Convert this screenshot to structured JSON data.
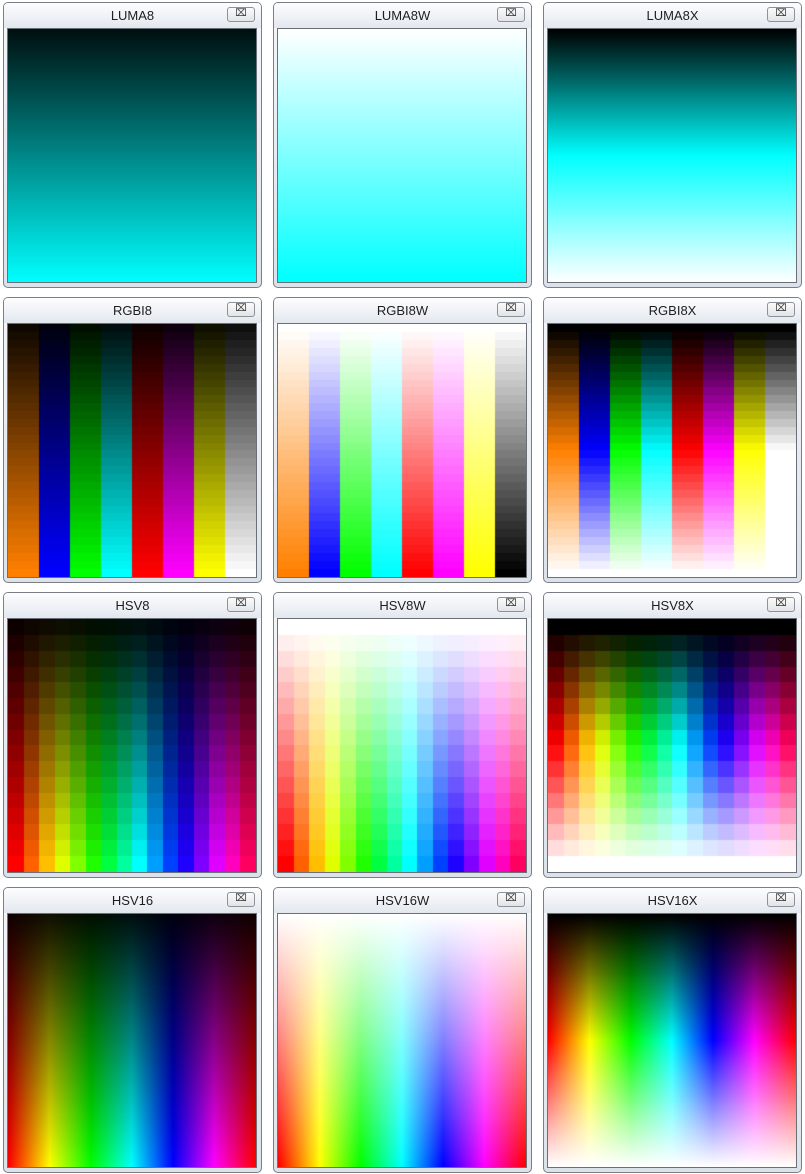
{
  "windows": [
    {
      "title": "LUMA8",
      "scheme": "luma",
      "mode": "dark",
      "steps": 0
    },
    {
      "title": "LUMA8W",
      "scheme": "luma",
      "mode": "white",
      "steps": 0
    },
    {
      "title": "LUMA8X",
      "scheme": "luma",
      "mode": "both",
      "steps": 0
    },
    {
      "title": "RGBI8",
      "scheme": "rgbi",
      "mode": "dark",
      "steps": 32
    },
    {
      "title": "RGBI8W",
      "scheme": "rgbi",
      "mode": "white",
      "steps": 32
    },
    {
      "title": "RGBI8X",
      "scheme": "rgbi",
      "mode": "both",
      "steps": 32
    },
    {
      "title": "HSV8",
      "scheme": "hsv",
      "mode": "dark",
      "steps": 16
    },
    {
      "title": "HSV8W",
      "scheme": "hsv",
      "mode": "white",
      "steps": 16
    },
    {
      "title": "HSV8X",
      "scheme": "hsv",
      "mode": "both",
      "steps": 16
    },
    {
      "title": "HSV16",
      "scheme": "hsv",
      "mode": "dark",
      "steps": 0
    },
    {
      "title": "HSV16W",
      "scheme": "hsv",
      "mode": "white",
      "steps": 0
    },
    {
      "title": "HSV16X",
      "scheme": "hsv",
      "mode": "both",
      "steps": 0
    }
  ],
  "close_glyph": "⌧",
  "colors": {
    "luma_hue": "#00ffff",
    "frame": "#7a7e85"
  }
}
